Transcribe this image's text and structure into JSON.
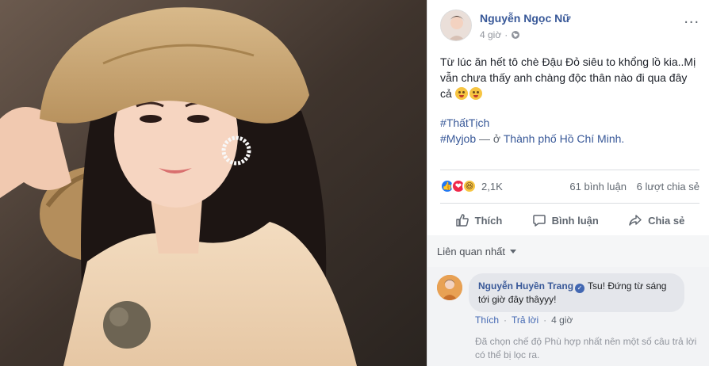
{
  "post": {
    "author": "Nguyễn Ngọc Nữ",
    "time": "4 giờ",
    "text_line1": "Từ lúc ăn hết tô chè Đậu Đỏ siêu to khổng lồ kia..Mị",
    "text_line2": "vẫn chưa thấy anh chàng độc thân nào đi qua đây",
    "text_line3": "cả",
    "hashtag1": "#ThấtTịch",
    "hashtag2": "#Myjob",
    "location_sep": " — ở ",
    "location": "Thành phố Hồ Chí Minh.",
    "more_label": "..."
  },
  "stats": {
    "reactions_count": "2,1K",
    "comments": "61 bình luận",
    "shares": "6 lượt chia sẻ"
  },
  "actions": {
    "like": "Thích",
    "comment": "Bình luận",
    "share": "Chia sẻ"
  },
  "filter": {
    "label": "Liên quan nhất"
  },
  "comment": {
    "author": "Nguyễn Huyền Trang",
    "text": "Tsu! Đứng từ sáng tới giờ đây thâyyy!",
    "like_label": "Thích",
    "reply_label": "Trả lời",
    "time": "4 giờ",
    "separator": "·"
  },
  "filter_note": "Đã chọn chế độ Phù hợp nhất nên một số câu trả lời có thể bị lọc ra.",
  "colors": {
    "link_blue": "#385898",
    "like_blue": "#2078f4",
    "love_red": "#f0284a",
    "haha_yellow": "#f7c542"
  },
  "icons": [
    "globe-icon",
    "like-icon",
    "comment-icon",
    "share-icon",
    "verified-icon",
    "caret-down-icon",
    "more-icon"
  ]
}
